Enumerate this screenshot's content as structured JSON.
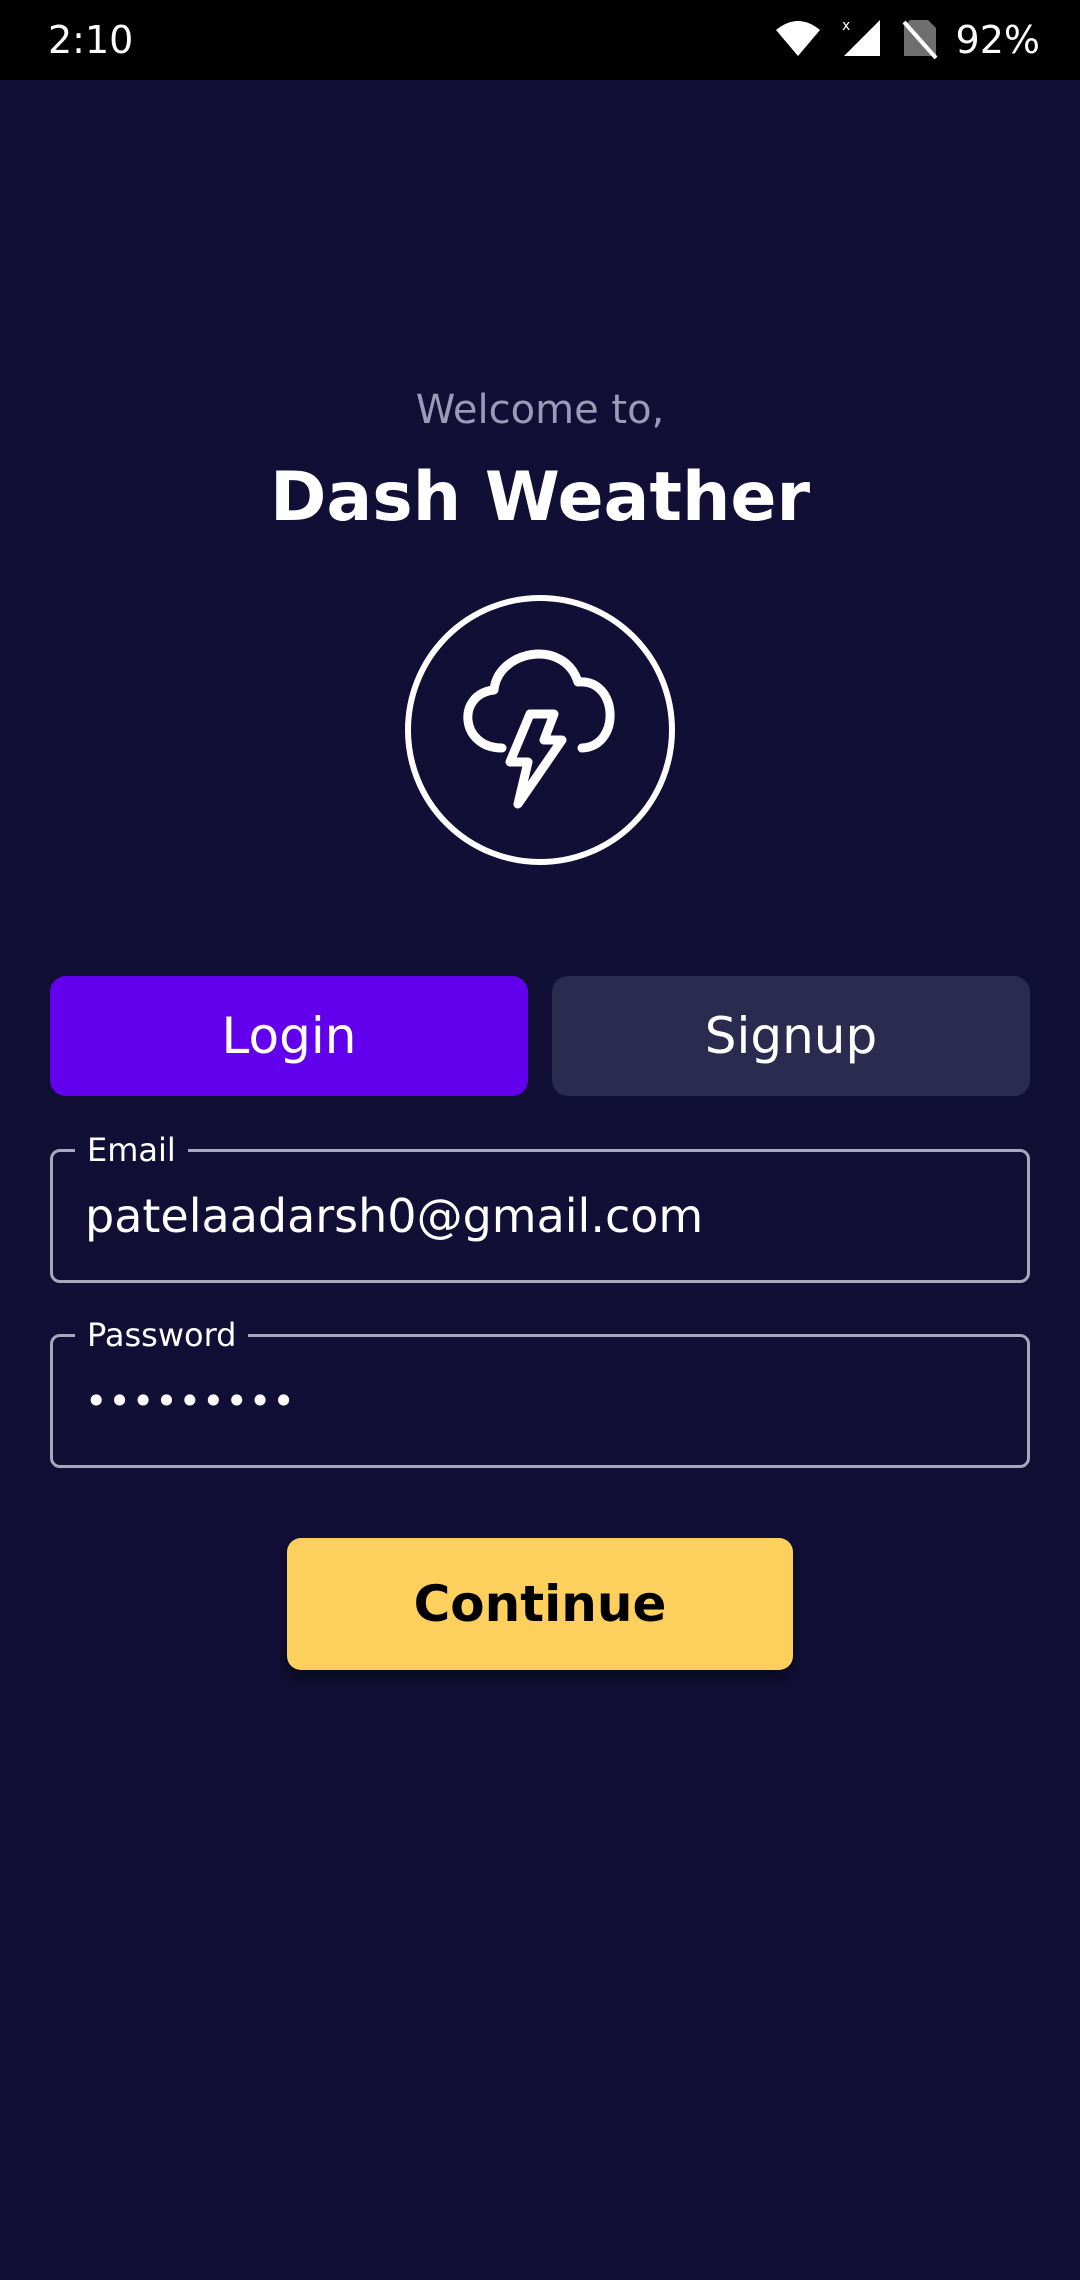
{
  "status_bar": {
    "time": "2:10",
    "battery": "92%",
    "icons": [
      "wifi-icon",
      "signal-icon",
      "no-sim-icon"
    ]
  },
  "welcome_text": "Welcome to,",
  "app_title": "Dash Weather",
  "logo_icon": "thunderstorm-cloud-icon",
  "tabs": {
    "login": "Login",
    "signup": "Signup",
    "active": "login"
  },
  "email": {
    "label": "Email",
    "value": "patelaadarsh0@gmail.com"
  },
  "password": {
    "label": "Password",
    "value": "•••••••••"
  },
  "continue_label": "Continue",
  "colors": {
    "background": "#110f36",
    "tab_active": "#6200ee",
    "tab_inactive": "#2b2a4f",
    "button": "#fdcf5d"
  }
}
